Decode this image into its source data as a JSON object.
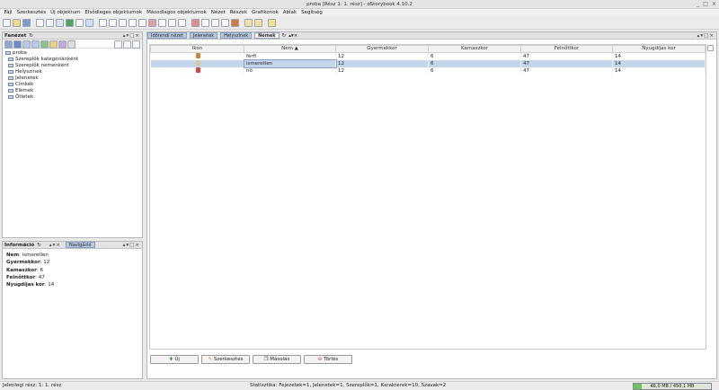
{
  "window": {
    "title": "proba [Rész 1: 1. rész] - oStorybook 4.10.2",
    "controls": [
      "_",
      "□",
      "×"
    ]
  },
  "menu": [
    "Fájl",
    "Szerkesztés",
    "Új objektum",
    "Elsődleges objektumok",
    "Másodlagos objektumok",
    "Nézet",
    "Részek",
    "Grafikonok",
    "Ablak",
    "Segítség"
  ],
  "left_panel": {
    "title": "Fanézet",
    "tree": [
      {
        "label": "proba",
        "indent": 0
      },
      {
        "label": "Szereplők kategóriánként",
        "indent": 1
      },
      {
        "label": "Szereplők nemenként",
        "indent": 1
      },
      {
        "label": "Helyszínek",
        "indent": 1
      },
      {
        "label": "Jelenetek",
        "indent": 1
      },
      {
        "label": "Címkék",
        "indent": 1
      },
      {
        "label": "Elemek",
        "indent": 1
      },
      {
        "label": "Ötletek",
        "indent": 1
      }
    ]
  },
  "info_panel": {
    "title": "Információ",
    "tab_nav": "Navigáció",
    "fields": [
      {
        "key": "Nem",
        "value": "ismeretlen"
      },
      {
        "key": "Gyermekkor",
        "value": "12"
      },
      {
        "key": "Kamaszkor",
        "value": "6"
      },
      {
        "key": "Felnőttkor",
        "value": "47"
      },
      {
        "key": "Nyugdíjas kor",
        "value": "14"
      }
    ]
  },
  "tabs": [
    "Időrendi nézet",
    "Jelenetek",
    "Helyszínek",
    "Nemek"
  ],
  "table": {
    "columns": [
      "Ikon",
      "Nem ▲",
      "Gyermekkor",
      "Kamaszkor",
      "Felnőttkor",
      "Nyugdíjas kor"
    ],
    "rows": [
      {
        "icon_color": "#c8843a",
        "cells": [
          "",
          "férfi",
          "12",
          "6",
          "47",
          "14"
        ]
      },
      {
        "icon_color": "#d9c8a0",
        "cells": [
          "",
          "ismeretlen",
          "12",
          "6",
          "47",
          "14"
        ],
        "selected": true
      },
      {
        "icon_color": "#d4473a",
        "cells": [
          "",
          "nő",
          "12",
          "6",
          "47",
          "14"
        ]
      }
    ]
  },
  "buttons": {
    "new": "Új",
    "edit": "Szerkesztés",
    "copy": "Másolás",
    "delete": "Törlés"
  },
  "status": {
    "left": "Jelenlegi rész: 1: 1. rész",
    "center": "Statisztika: Fejezetek=1, Jelenetek=1, Szereplők=1, Karakterek=10, Szavak=2",
    "memory": "46,0 MB / 450,1 MB",
    "memory_fraction": 0.1
  }
}
